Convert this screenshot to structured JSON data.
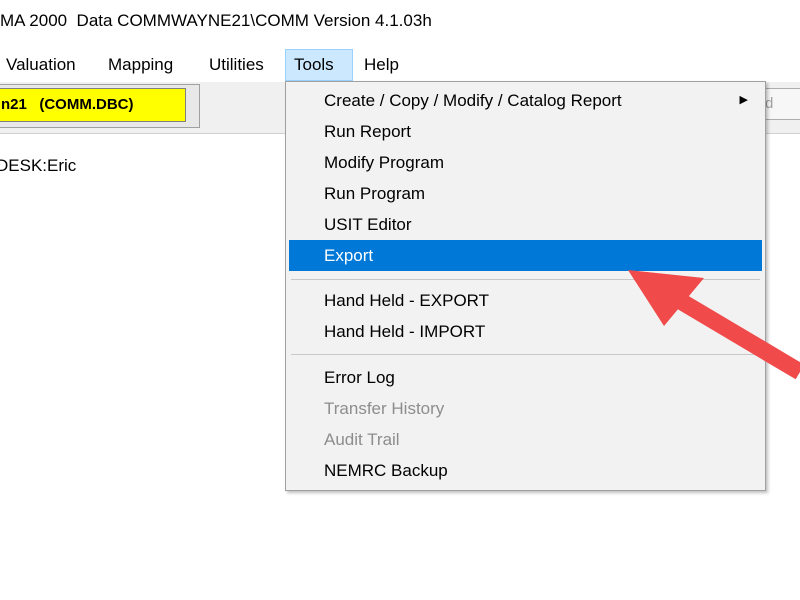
{
  "window": {
    "title": "MA 2000  Data COMMWAYNE21\\COMM Version 4.1.03h"
  },
  "menu": {
    "items": [
      {
        "label": "Valuation"
      },
      {
        "label": "Mapping"
      },
      {
        "label": "Utilities"
      },
      {
        "label": "Tools"
      },
      {
        "label": "Help"
      }
    ]
  },
  "database": {
    "label": "n21   (COMM.DBC)"
  },
  "right_button": {
    "label": "d"
  },
  "user": {
    "label": "DESK:Eric"
  },
  "tools_menu": {
    "items": [
      {
        "label": "Create / Copy / Modify / Catalog Report",
        "submenu_indicator": "▶"
      },
      {
        "label": "Run Report"
      },
      {
        "label": "Modify Program"
      },
      {
        "label": "Run Program"
      },
      {
        "label": "USIT Editor"
      },
      {
        "label": "Export",
        "state": "highlighted"
      },
      {
        "label": "Hand Held - EXPORT"
      },
      {
        "label": "Hand Held - IMPORT"
      },
      {
        "label": "Error Log"
      },
      {
        "label": "Transfer History",
        "state": "disabled"
      },
      {
        "label": "Audit Trail",
        "state": "disabled"
      },
      {
        "label": "NEMRC Backup"
      }
    ]
  },
  "colors": {
    "highlight": "#0078d7",
    "database_field": "#ffff00",
    "annotation_arrow": "#f04a4a"
  }
}
